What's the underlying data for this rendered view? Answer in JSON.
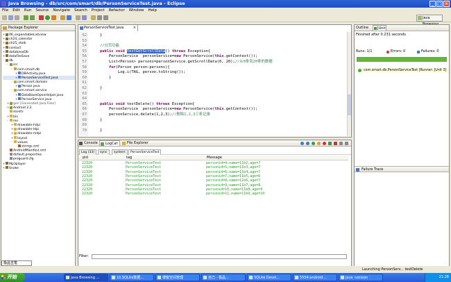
{
  "window": {
    "title": "Java Browsing - db/src/com/smart/db/PersonServiceTest.java - Eclipse"
  },
  "menu": [
    "File",
    "Edit",
    "Run",
    "Source",
    "Navigate",
    "Search",
    "Project",
    "Refactor",
    "Window",
    "Help"
  ],
  "perspective": {
    "label": "Java Browsing"
  },
  "package_explorer": {
    "title": "Package Explorer",
    "items": [
      {
        "indent": 0,
        "label": "06_expandableListview",
        "tri": "+",
        "color": "#8a6d3b"
      },
      {
        "indent": 0,
        "label": "ch24_calendar",
        "tri": "+",
        "color": "#8a6d3b"
      },
      {
        "indent": 0,
        "label": "ch25_stalk",
        "tri": "+",
        "color": "#8a6d3b"
      },
      {
        "indent": 0,
        "label": "contact",
        "tri": "+",
        "color": "#8a6d3b"
      },
      {
        "indent": 0,
        "label": "databaseDb",
        "tri": "+",
        "color": "#8a6d3b"
      },
      {
        "indent": 0,
        "label": "dataFileSave",
        "tri": "+",
        "color": "#8a6d3b"
      },
      {
        "indent": 0,
        "label": "db",
        "tri": "-",
        "color": "#8a6d3b"
      },
      {
        "indent": 1,
        "label": "src",
        "tri": "-",
        "color": "#b08a30"
      },
      {
        "indent": 2,
        "label": "com.smart.db",
        "tri": "-",
        "color": "#c8a040"
      },
      {
        "indent": 3,
        "label": "DBActivity.java",
        "tri": "+",
        "color": "#4a7ad0"
      },
      {
        "indent": 3,
        "label": "PersonServiceTest.java",
        "tri": "+",
        "color": "#4a7ad0"
      },
      {
        "indent": 2,
        "label": "com.smart.domain",
        "tri": "-",
        "color": "#c8a040"
      },
      {
        "indent": 3,
        "label": "Person.java",
        "tri": "+",
        "color": "#4a7ad0"
      },
      {
        "indent": 2,
        "label": "com.smart.service",
        "tri": "-",
        "color": "#c8a040"
      },
      {
        "indent": 3,
        "label": "DataBaseOpenHelper.java",
        "tri": "+",
        "color": "#4a7ad0"
      },
      {
        "indent": 3,
        "label": "PersonService.java",
        "tri": "+",
        "color": "#4a7ad0"
      },
      {
        "indent": 1,
        "label": "gen [Generated Java Files]",
        "tri": "+",
        "color": "#b08a30"
      },
      {
        "indent": 1,
        "label": "Android 2.2",
        "tri": "+",
        "color": "#6aa04a"
      },
      {
        "indent": 1,
        "label": "assets",
        "tri": "",
        "color": "#d8b040"
      },
      {
        "indent": 1,
        "label": "bin",
        "tri": "+",
        "color": "#d8b040"
      },
      {
        "indent": 1,
        "label": "res",
        "tri": "-",
        "color": "#d8b040"
      },
      {
        "indent": 2,
        "label": "drawable-hdpi",
        "tri": "+",
        "color": "#d8b040"
      },
      {
        "indent": 2,
        "label": "drawable-ldpi",
        "tri": "+",
        "color": "#d8b040"
      },
      {
        "indent": 2,
        "label": "drawable-mdpi",
        "tri": "+",
        "color": "#d8b040"
      },
      {
        "indent": 2,
        "label": "layout",
        "tri": "+",
        "color": "#d8b040"
      },
      {
        "indent": 2,
        "label": "values",
        "tri": "-",
        "color": "#d8b040"
      },
      {
        "indent": 3,
        "label": "strings.xml",
        "tri": "",
        "color": "#a06030"
      },
      {
        "indent": 1,
        "label": "AndroidManifest.xml",
        "tri": "",
        "color": "#a06030"
      },
      {
        "indent": 1,
        "label": "default.properties",
        "tri": "",
        "color": "#888888"
      },
      {
        "indent": 1,
        "label": "proguard.cfg",
        "tri": "",
        "color": "#888888"
      },
      {
        "indent": 0,
        "label": "Mp3player",
        "tri": "+",
        "color": "#8a6d3b"
      },
      {
        "indent": 0,
        "label": "Snake",
        "tri": "+",
        "color": "#8a6d3b"
      }
    ]
  },
  "editor": {
    "tab_label": "PersonServiceTest.java",
    "lines": [
      {
        "n": "52",
        "html": "    }"
      },
      {
        "n": "53",
        "html": ""
      },
      {
        "n": "54",
        "html": "    <span class=\"cm\">//分页功能</span>"
      },
      {
        "n": "55",
        "html": "    <span class=\"kw\">public void</span> <span class=\"sel\">testGetScrollData</span>() <span class=\"kw\">throws</span> Exception{"
      },
      {
        "n": "56",
        "html": "        PersonService  personService=<span class=\"kw\">new</span> PersonService(<span class=\"kw\">this</span>.getContext());"
      },
      {
        "n": "57",
        "html": "        List&lt;Person&gt; persons=personService.getScrollData(0, 20);<span class=\"cm\">//从0条到20条的数据</span>"
      },
      {
        "n": "58",
        "html": "        <span class=\"kw\">for</span>(Person person:persons){"
      },
      {
        "n": "59",
        "html": "            Log.i(TAG, person.toString());"
      },
      {
        "n": "60",
        "html": "        }"
      },
      {
        "n": "61",
        "html": ""
      },
      {
        "n": "62",
        "html": "    }"
      },
      {
        "n": "63",
        "html": ""
      },
      {
        "n": "64",
        "html": ""
      },
      {
        "n": "65",
        "html": "    <span class=\"kw\">public void</span> testDelete() <span class=\"kw\">throws</span> Exception{"
      },
      {
        "n": "66",
        "html": "        PersonService  personService=<span class=\"kw\">new</span> PersonService(<span class=\"kw\">this</span>.getContext());"
      },
      {
        "n": "67",
        "html": "        personService.delete(1,2,3);<span class=\"cm\">//删除1,2,3三条记录</span>"
      },
      {
        "n": "68",
        "html": "    }"
      },
      {
        "n": "69",
        "html": ""
      },
      {
        "n": "70",
        "html": "    }"
      }
    ]
  },
  "console": {
    "tabs": [
      "Console",
      "LogCat",
      "File Explorer"
    ],
    "log_tabs": [
      "Log (33)",
      "sync",
      "system",
      "PersonServiceTest"
    ],
    "columns": [
      "pid",
      "tag",
      "Message"
    ],
    "rows": [
      [
        "22320",
        "PersonServiceTest",
        "personid=4,name=11b2,age=7"
      ],
      [
        "22320",
        "PersonServiceTest",
        "personid=5,name=11b3,age=7"
      ],
      [
        "22320",
        "PersonServiceTest",
        "personid=6,name=11b4,age=7"
      ],
      [
        "22320",
        "PersonServiceTest",
        "personid=7,name=11b5,age=6"
      ],
      [
        "22320",
        "PersonServiceTest",
        "personid=8,name=11b6,age=7"
      ],
      [
        "22320",
        "PersonServiceTest",
        "personid=9,name=11b7,age=8"
      ],
      [
        "22320",
        "PersonServiceTest",
        "personid=10,name=11b8,age=9"
      ],
      [
        "22320",
        "PersonServiceTest",
        "personid=11,name=11b9,age=10"
      ]
    ],
    "filter_label": "Filter:"
  },
  "junit": {
    "tabs": [
      "Outline",
      "JUnit"
    ],
    "status": "Finished after 0.231 seconds",
    "runs": "Runs:  1/1",
    "errors": "Errors:  0",
    "failures": "Failures:  0",
    "test_row": "com.smart.db.PersonServiceTest [Runner: JUnit 3]",
    "failure_trace": "Failure Trace",
    "bar_color": "#5fba2e"
  },
  "status_bar": {
    "text": "Launching PersonServ...  testDelete"
  },
  "ime": {
    "label": "极品五笔"
  },
  "taskbar": {
    "start": "开始",
    "tasks": [
      "Java Browsing ...",
      "10.SQLite数据...",
      "博客空间管理",
      "自己 - 极品...",
      "SQLite Devel...",
      "5554:android...",
      "java -version"
    ],
    "clock": "21:28"
  }
}
